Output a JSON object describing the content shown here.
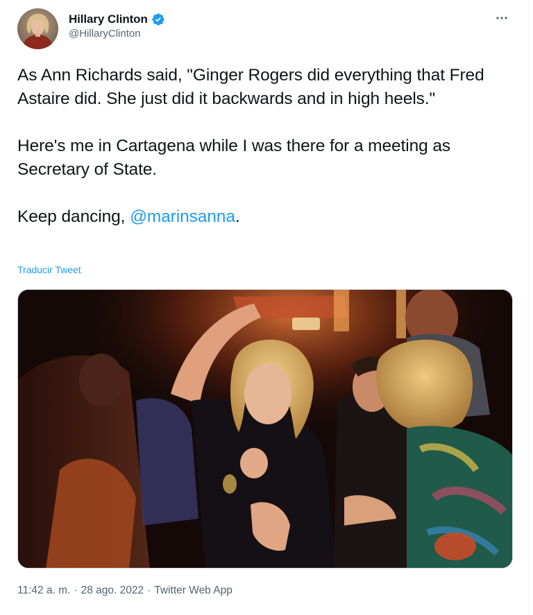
{
  "author": {
    "display_name": "Hillary Clinton",
    "handle": "@HillaryClinton",
    "verified": true,
    "avatar_icon": "profile-avatar",
    "verified_color": "#1d9bf0"
  },
  "tweet": {
    "paragraph1": "As Ann Richards said, \"Ginger Rogers did everything that Fred Astaire did. She just did it backwards and in high heels.\"",
    "paragraph2": "Here's me in Cartagena while I was there for a meeting as Secretary of State.",
    "paragraph3_prefix": "Keep dancing, ",
    "mention": "@marinsanna",
    "paragraph3_suffix": ".",
    "translate_label": "Traducir Tweet"
  },
  "meta": {
    "time": "11:42 a. m.",
    "separator": "·",
    "date": "28 ago. 2022",
    "source": "Twitter Web App"
  },
  "colors": {
    "link": "#1d9bf0",
    "text": "#0f1419",
    "secondary": "#536471"
  },
  "icons": {
    "more": "more-horizontal-icon",
    "verified": "verified-badge-icon"
  }
}
